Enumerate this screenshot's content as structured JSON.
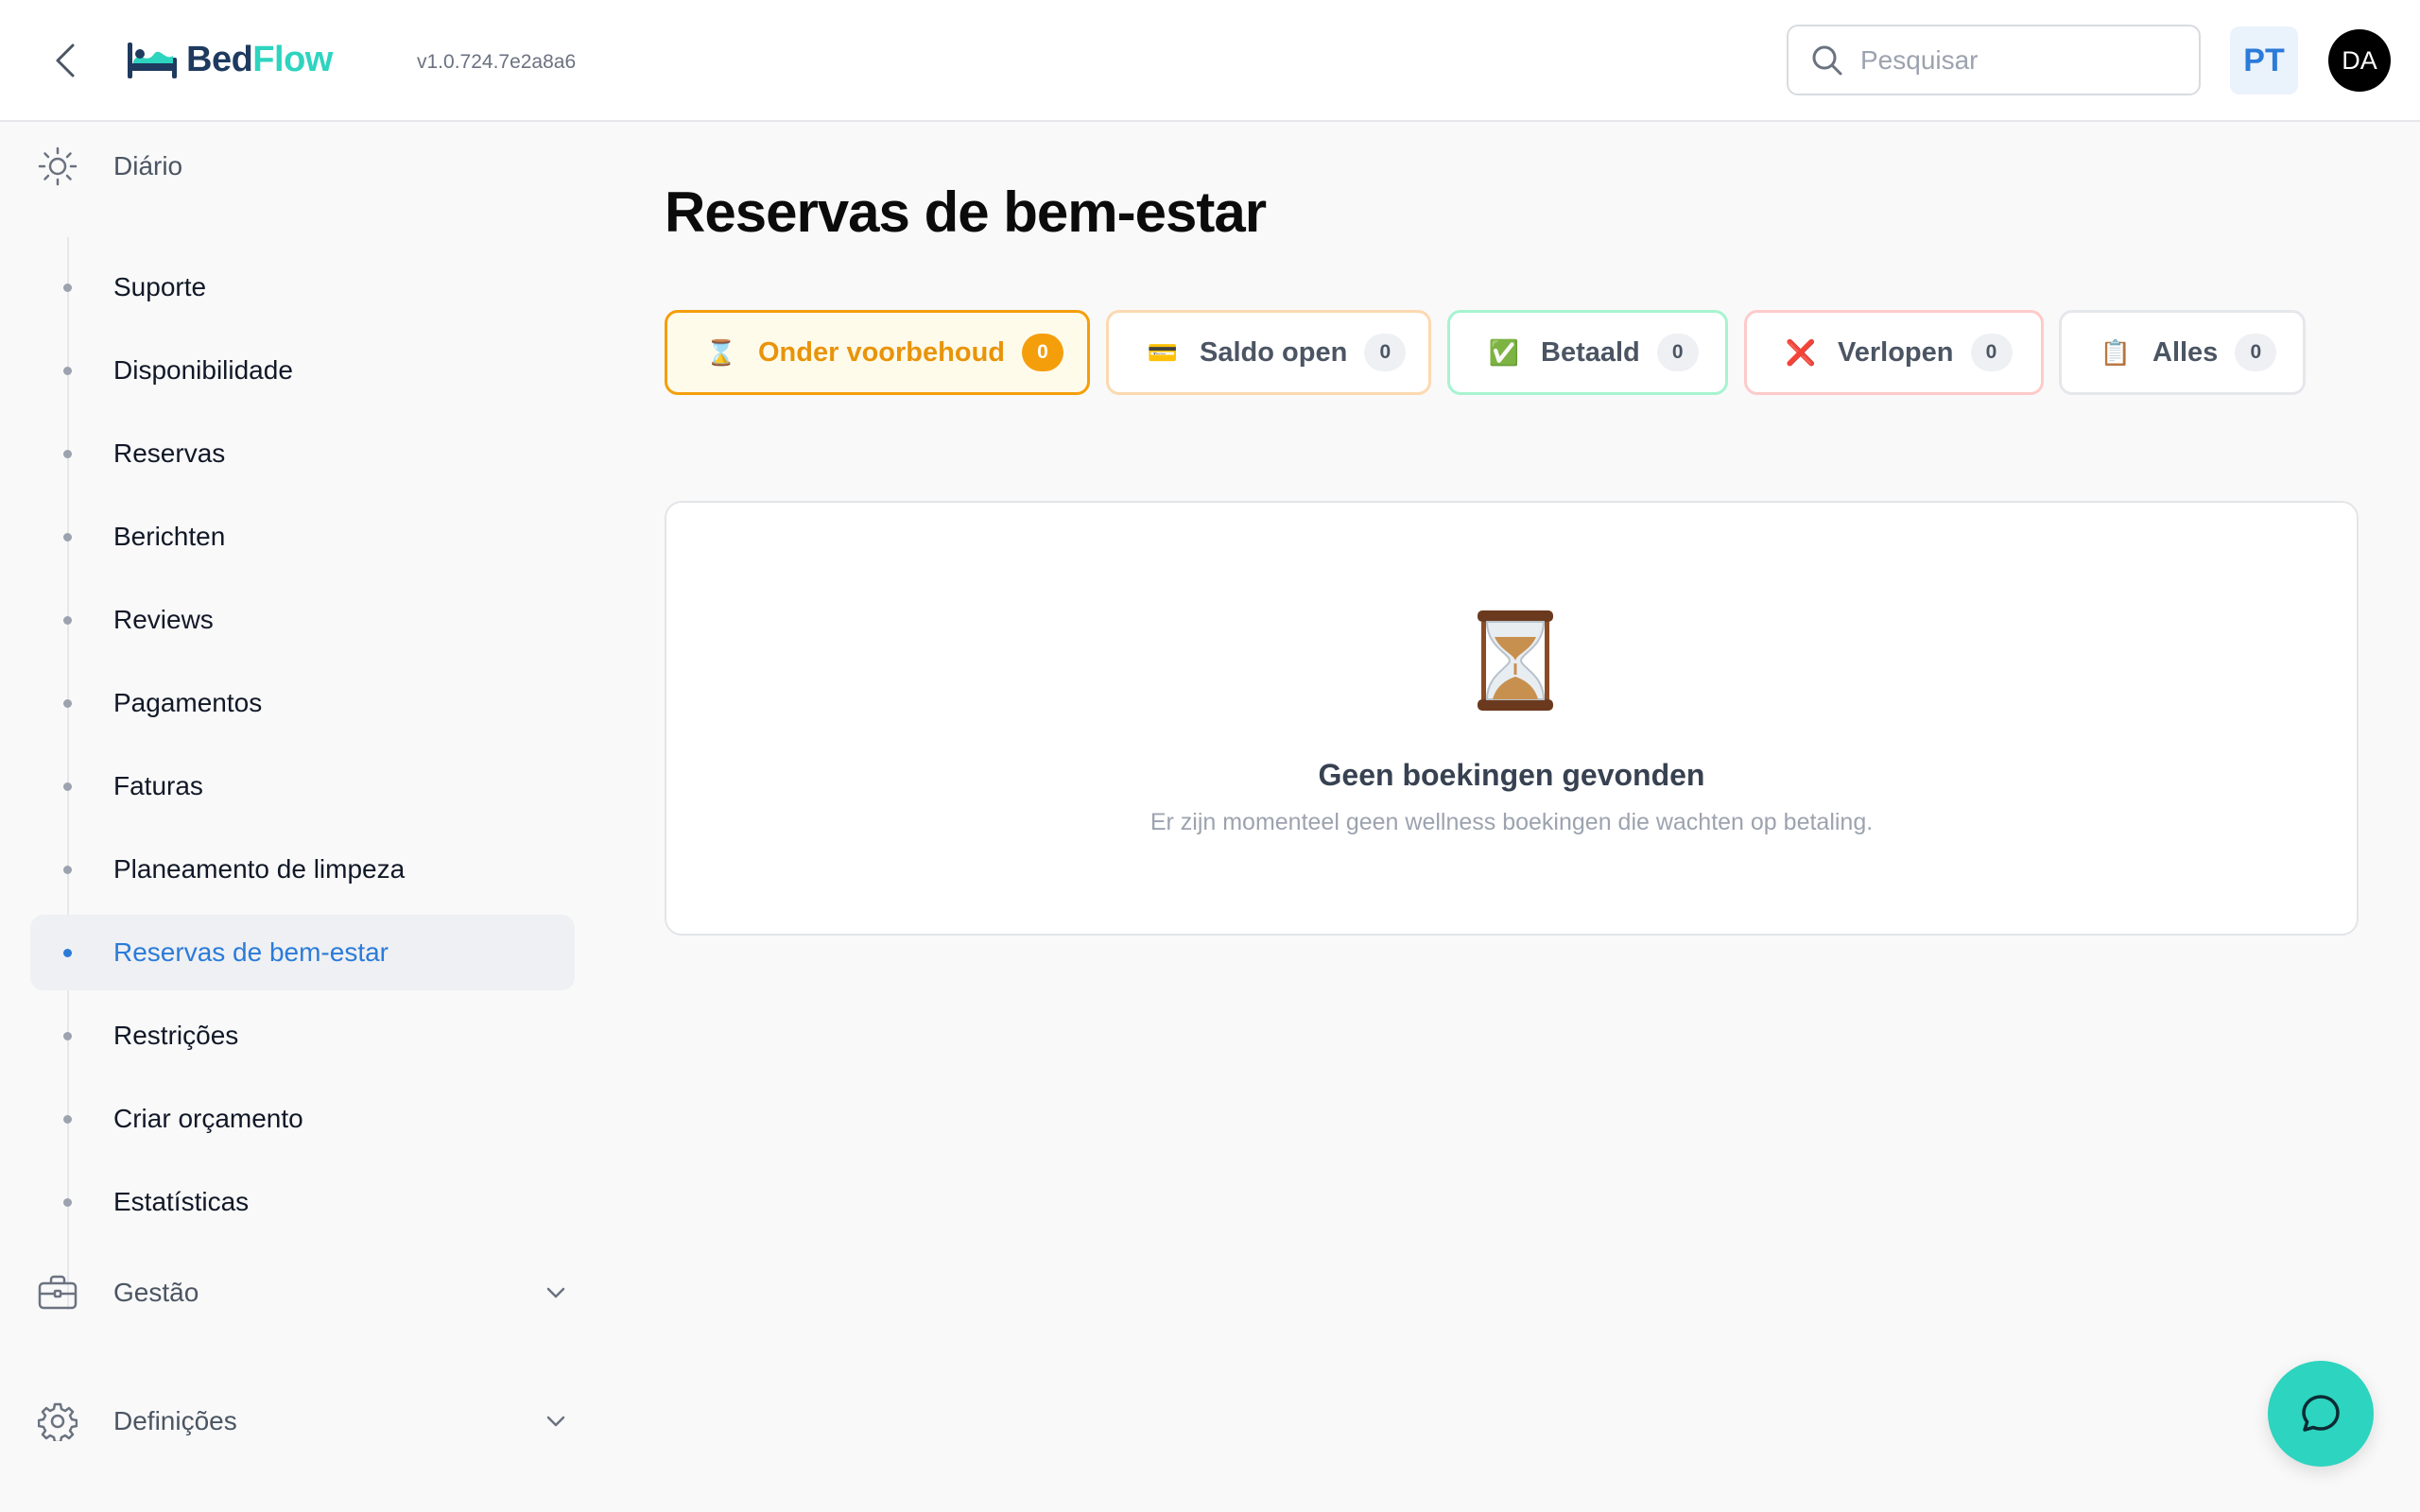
{
  "header": {
    "logo": {
      "part1": "Bed",
      "part2": "Flow"
    },
    "version": "v1.0.724.7e2a8a6",
    "search_placeholder": "Pesquisar",
    "language": "PT",
    "avatar_initials": "DA",
    "back_icon": "chevron-left-icon"
  },
  "sidebar": {
    "daily": {
      "label": "Diário",
      "icon": "sun-icon"
    },
    "items": [
      {
        "label": "Suporte"
      },
      {
        "label": "Disponibilidade"
      },
      {
        "label": "Reservas"
      },
      {
        "label": "Berichten"
      },
      {
        "label": "Reviews"
      },
      {
        "label": "Pagamentos"
      },
      {
        "label": "Faturas"
      },
      {
        "label": "Planeamento de limpeza"
      },
      {
        "label": "Reservas de bem-estar",
        "active": true
      },
      {
        "label": "Restrições"
      },
      {
        "label": "Criar orçamento"
      },
      {
        "label": "Estatísticas"
      }
    ],
    "management": {
      "label": "Gestão",
      "icon": "briefcase-icon"
    },
    "settings": {
      "label": "Definições",
      "icon": "gear-icon"
    }
  },
  "main": {
    "title": "Reservas de bem-estar",
    "filters": [
      {
        "label": "Onder voorbehoud",
        "count": "0",
        "emoji": "⌛",
        "border": "#f59e0b",
        "color": "#e8940a",
        "count_bg": "#f59e0b",
        "count_color": "#ffffff",
        "active": true
      },
      {
        "label": "Saldo open",
        "count": "0",
        "emoji": "💳",
        "border": "#fcd9b0",
        "color": "#4b5563",
        "count_bg": "#eef0f3",
        "count_color": "#4b5563"
      },
      {
        "label": "Betaald",
        "count": "0",
        "emoji": "✅",
        "border": "#a7f3d0",
        "color": "#4b5563",
        "count_bg": "#eef0f3",
        "count_color": "#4b5563"
      },
      {
        "label": "Verlopen",
        "count": "0",
        "emoji": "❌",
        "border": "#fecaca",
        "color": "#4b5563",
        "count_bg": "#eef0f3",
        "count_color": "#4b5563"
      },
      {
        "label": "Alles",
        "count": "0",
        "emoji": "📋",
        "border": "#e5e7eb",
        "color": "#4b5563",
        "count_bg": "#eef0f3",
        "count_color": "#4b5563"
      }
    ],
    "empty_state": {
      "icon": "hourglass-icon",
      "title": "Geen boekingen gevonden",
      "subtitle": "Er zijn momenteel geen wellness boekingen die wachten op betaling."
    }
  },
  "chat_icon": "chat-bubble-icon"
}
